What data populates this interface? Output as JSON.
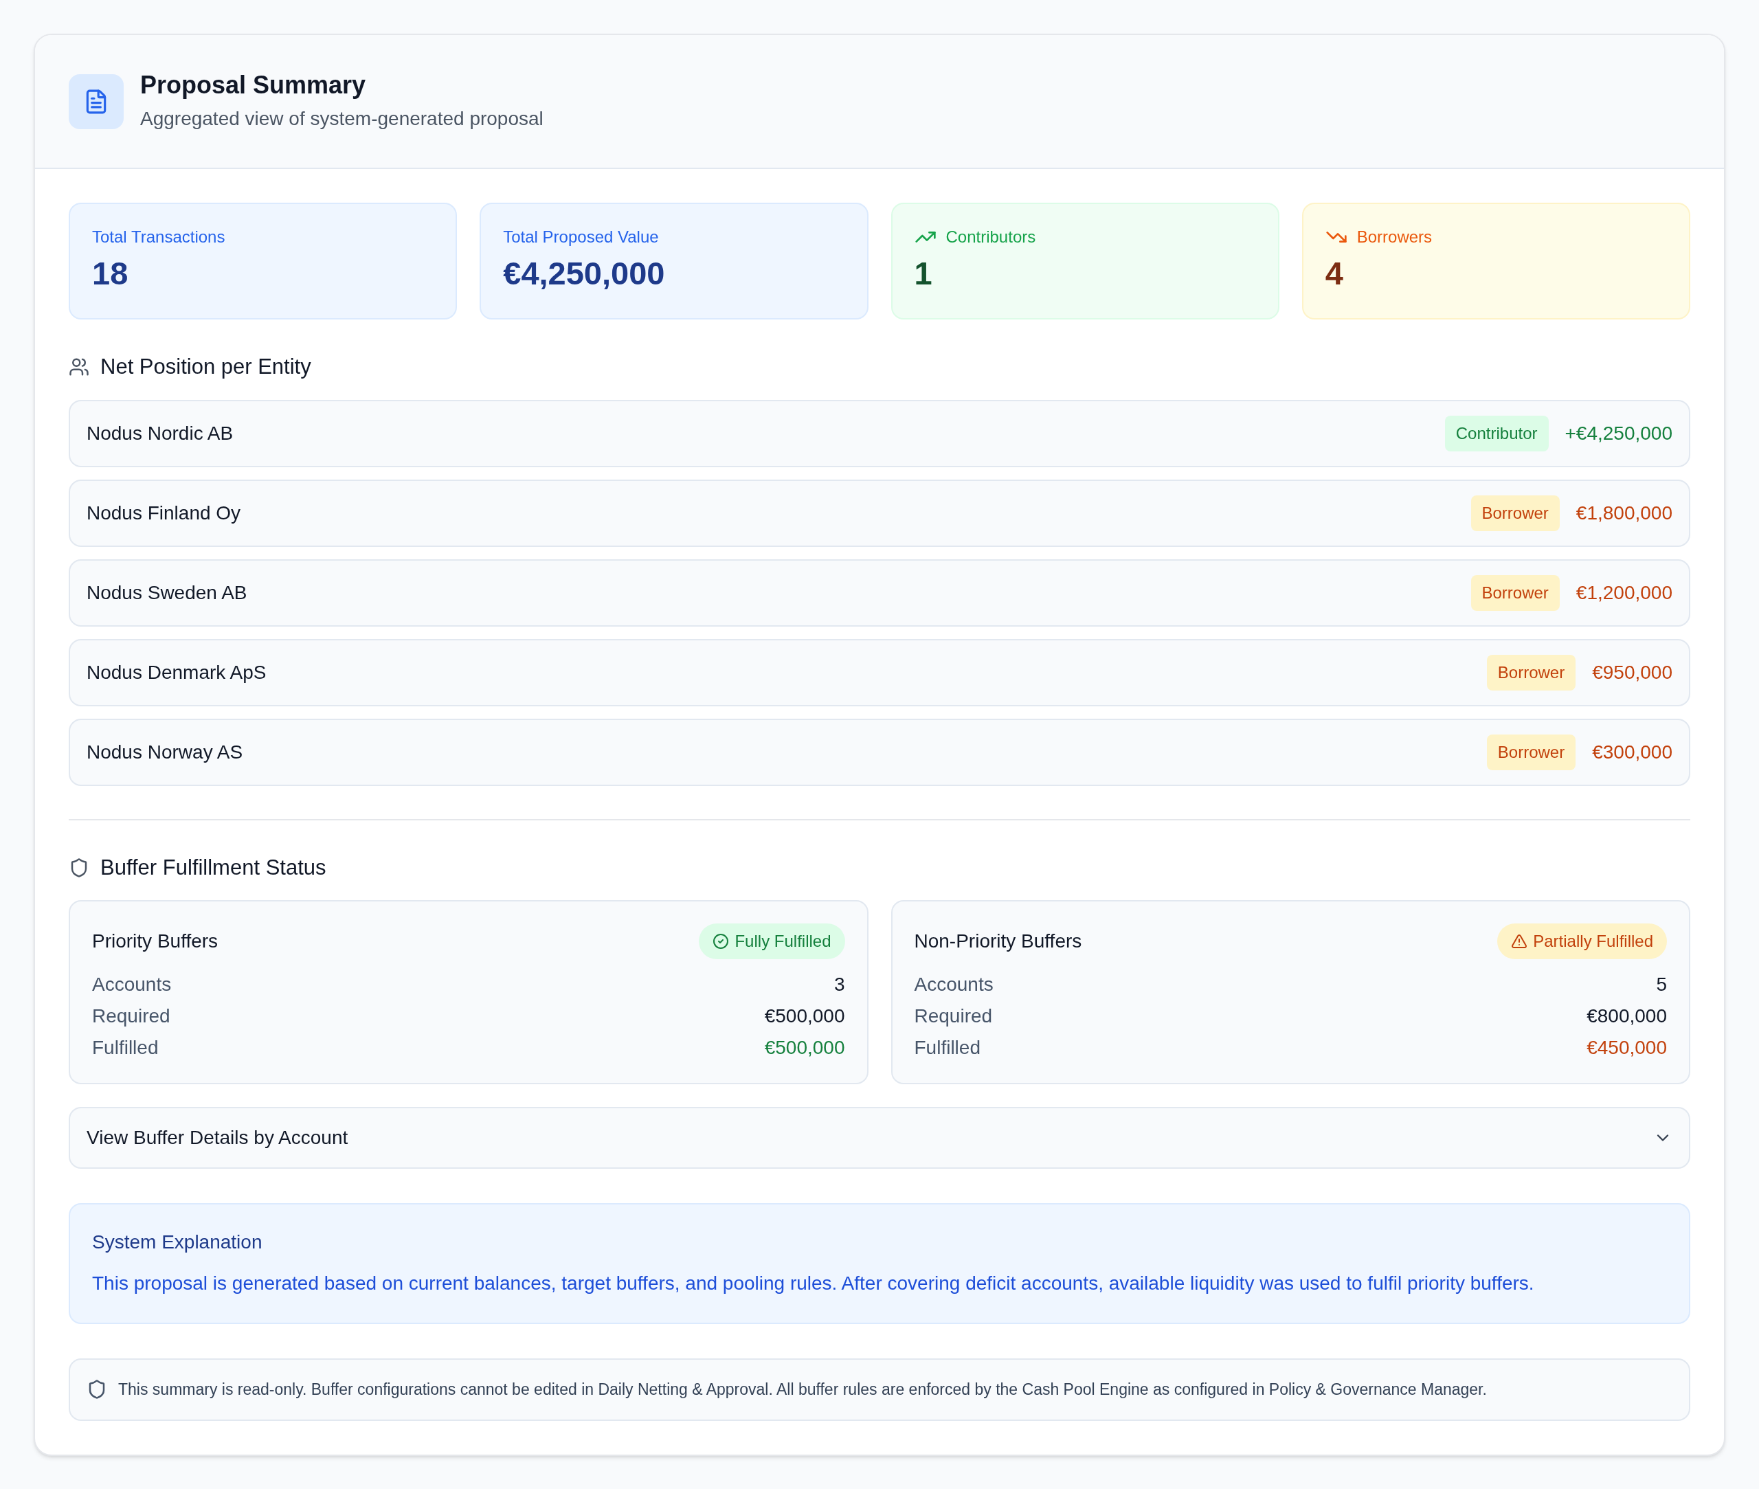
{
  "header": {
    "title": "Proposal Summary",
    "subtitle": "Aggregated view of system-generated proposal"
  },
  "stats": [
    {
      "label": "Total Transactions",
      "value": "18",
      "kind": "neutral"
    },
    {
      "label": "Total Proposed Value",
      "value": "€4,250,000",
      "kind": "neutral"
    },
    {
      "label": "Contributors",
      "value": "1",
      "kind": "up"
    },
    {
      "label": "Borrowers",
      "value": "4",
      "kind": "down"
    }
  ],
  "net_position": {
    "title": "Net Position per Entity",
    "entities": [
      {
        "name": "Nodus Nordic AB",
        "role": "Contributor",
        "amount": "+€4,250,000",
        "kind": "contributor"
      },
      {
        "name": "Nodus Finland Oy",
        "role": "Borrower",
        "amount": "€1,800,000",
        "kind": "borrower"
      },
      {
        "name": "Nodus Sweden AB",
        "role": "Borrower",
        "amount": "€1,200,000",
        "kind": "borrower"
      },
      {
        "name": "Nodus Denmark ApS",
        "role": "Borrower",
        "amount": "€950,000",
        "kind": "borrower"
      },
      {
        "name": "Nodus Norway AS",
        "role": "Borrower",
        "amount": "€300,000",
        "kind": "borrower"
      }
    ]
  },
  "buffers": {
    "title": "Buffer Fulfillment Status",
    "cards": [
      {
        "title": "Priority Buffers",
        "status": "Fully Fulfilled",
        "kind": "fulfilled",
        "rows": [
          {
            "label": "Accounts",
            "value": "3",
            "kind": "plain"
          },
          {
            "label": "Required",
            "value": "€500,000",
            "kind": "plain"
          },
          {
            "label": "Fulfilled",
            "value": "€500,000",
            "kind": "result"
          }
        ]
      },
      {
        "title": "Non-Priority Buffers",
        "status": "Partially Fulfilled",
        "kind": "partial",
        "rows": [
          {
            "label": "Accounts",
            "value": "5",
            "kind": "plain"
          },
          {
            "label": "Required",
            "value": "€800,000",
            "kind": "plain"
          },
          {
            "label": "Fulfilled",
            "value": "€450,000",
            "kind": "result"
          }
        ]
      }
    ]
  },
  "details_toggle": {
    "label": "View Buffer Details by Account",
    "expanded": false
  },
  "explanation": {
    "title": "System Explanation",
    "text": "This proposal is generated based on current balances, target buffers, and pooling rules. After covering deficit accounts, available liquidity was used to fulfil priority buffers."
  },
  "footer_note": "This summary is read-only. Buffer configurations cannot be edited in Daily Netting & Approval. All buffer rules are enforced by the Cash Pool Engine as configured in Policy & Governance Manager."
}
